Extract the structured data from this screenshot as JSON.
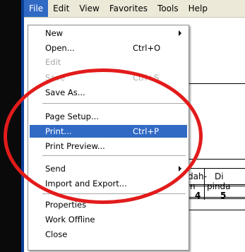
{
  "menubar": {
    "items": [
      "File",
      "Edit",
      "View",
      "Favorites",
      "Tools",
      "Help"
    ],
    "active": "File"
  },
  "file_menu": {
    "items": [
      {
        "label": "New",
        "shortcut": "",
        "submenu": true,
        "disabled": false
      },
      {
        "label": "Open...",
        "shortcut": "Ctrl+O",
        "disabled": false
      },
      {
        "label": "Edit",
        "shortcut": "",
        "disabled": true
      },
      {
        "label": "Save",
        "shortcut": "Ctrl+S",
        "disabled": true
      },
      {
        "label": "Save As...",
        "shortcut": "",
        "disabled": false
      },
      {
        "label": "Page Setup...",
        "shortcut": "",
        "disabled": false
      },
      {
        "label": "Print...",
        "shortcut": "Ctrl+P",
        "disabled": false,
        "highlighted": true
      },
      {
        "label": "Print Preview...",
        "shortcut": "",
        "disabled": false
      },
      {
        "label": "Send",
        "shortcut": "",
        "submenu": true,
        "disabled": false
      },
      {
        "label": "Import and Export...",
        "shortcut": "",
        "disabled": false
      },
      {
        "label": "Properties",
        "shortcut": "",
        "disabled": false
      },
      {
        "label": "Work Offline",
        "shortcut": "",
        "disabled": false
      },
      {
        "label": "Close",
        "shortcut": "",
        "disabled": false
      }
    ]
  },
  "document": {
    "cells": {
      "c1_top": "dah-",
      "c1_bottom": "n",
      "c2_top": "Di",
      "c2_bottom": "pinda",
      "c1_num": "4",
      "c2_num": "5"
    }
  },
  "colors": {
    "menu_highlight": "#316ac5",
    "annotation_red": "#e21b1b",
    "menubar_bg": "#ece9d8"
  }
}
